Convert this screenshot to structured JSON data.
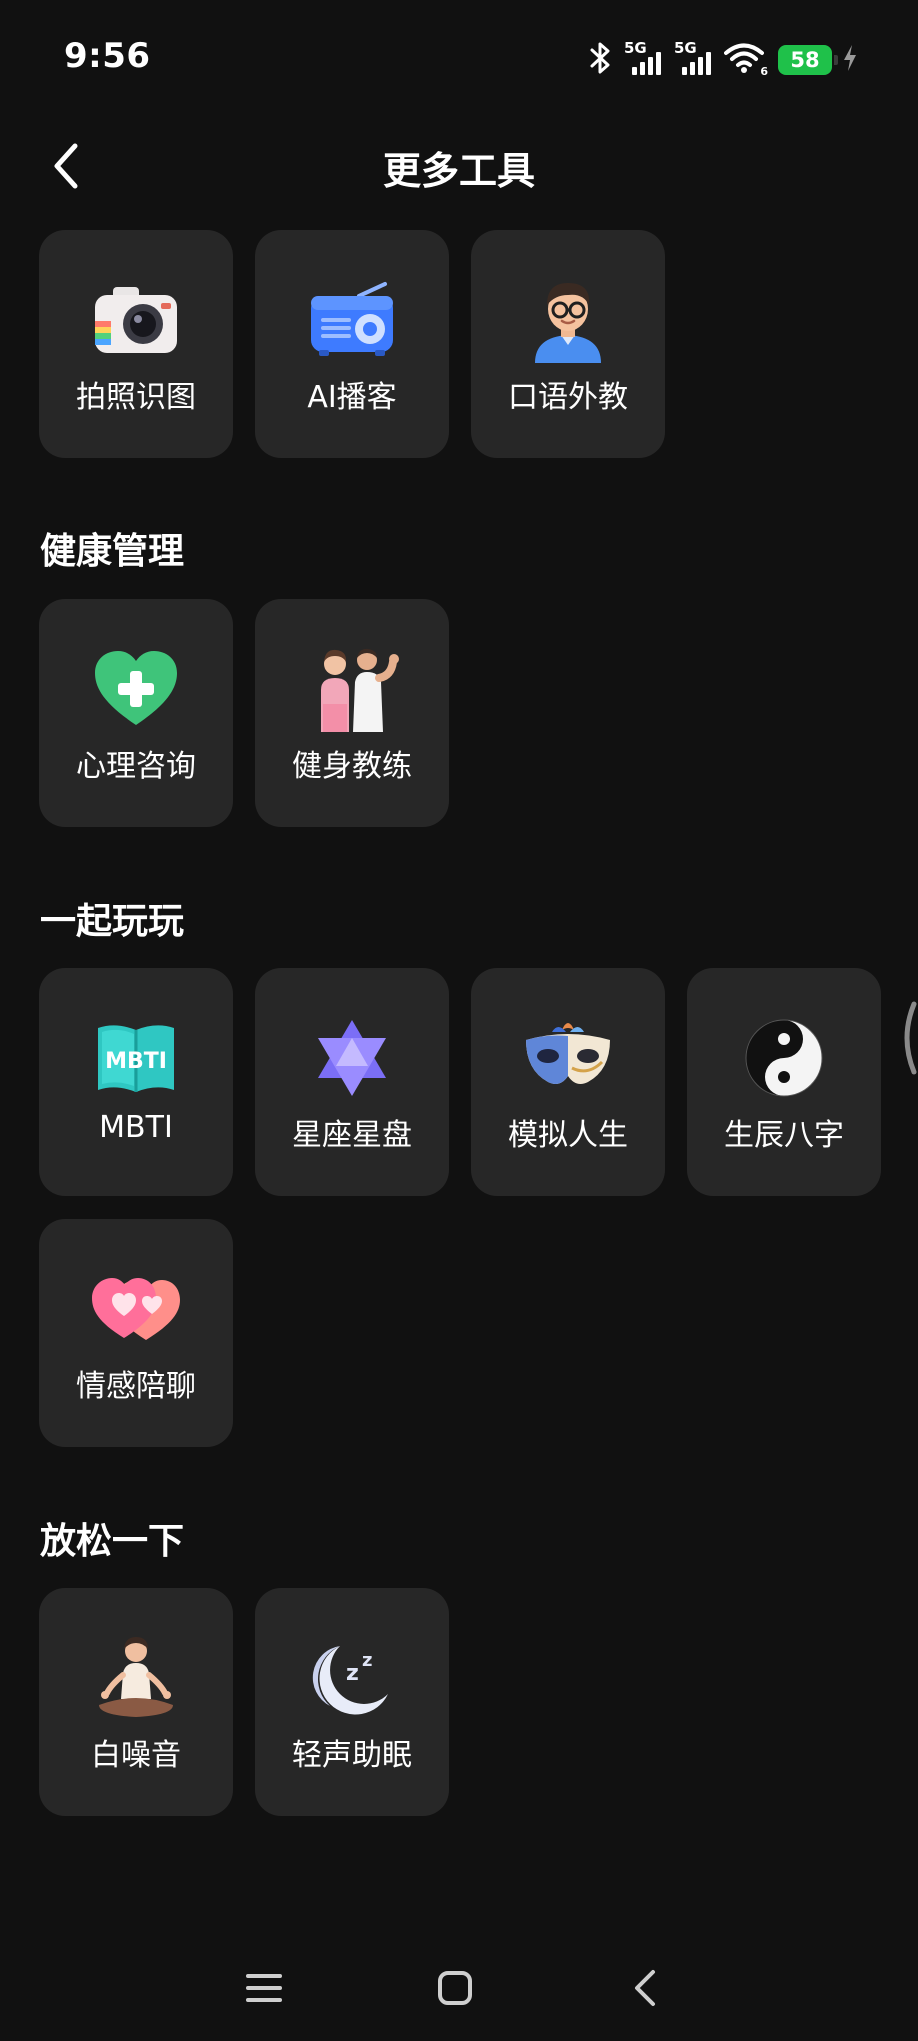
{
  "status": {
    "time": "9:56",
    "network_1": "5G",
    "network_2": "5G",
    "wifi_badge": "6",
    "battery": "58",
    "icons": [
      "bluetooth-icon",
      "signal-icon",
      "wifi-icon",
      "battery-icon",
      "charging-icon"
    ]
  },
  "header": {
    "title": "更多工具",
    "back_icon": "back-arrow-icon"
  },
  "top_tools": [
    {
      "label": "拍照识图",
      "icon": "camera-icon"
    },
    {
      "label": "AI播客",
      "icon": "radio-icon"
    },
    {
      "label": "口语外教",
      "icon": "tutor-avatar-icon"
    }
  ],
  "sections": {
    "health": {
      "title": "健康管理",
      "items": [
        {
          "label": "心理咨询",
          "icon": "heart-plus-icon"
        },
        {
          "label": "健身教练",
          "icon": "fitness-couple-icon"
        }
      ]
    },
    "play": {
      "title": "一起玩玩",
      "items": [
        {
          "label": "MBTI",
          "icon": "mbti-book-icon",
          "icon_text": "MBTI"
        },
        {
          "label": "星座星盘",
          "icon": "hexagram-star-icon"
        },
        {
          "label": "模拟人生",
          "icon": "masquerade-mask-icon"
        },
        {
          "label": "生辰八字",
          "icon": "yin-yang-icon"
        },
        {
          "label": "情感陪聊",
          "icon": "double-heart-icon"
        }
      ]
    },
    "relax": {
      "title": "放松一下",
      "items": [
        {
          "label": "白噪音",
          "icon": "meditation-icon"
        },
        {
          "label": "轻声助眠",
          "icon": "moon-sleep-icon"
        }
      ]
    }
  },
  "nav": {
    "icons": [
      "menu-icon",
      "home-icon",
      "back-icon"
    ]
  },
  "colors": {
    "background": "#111111",
    "tile": "#272727",
    "battery": "#1fc14a"
  }
}
